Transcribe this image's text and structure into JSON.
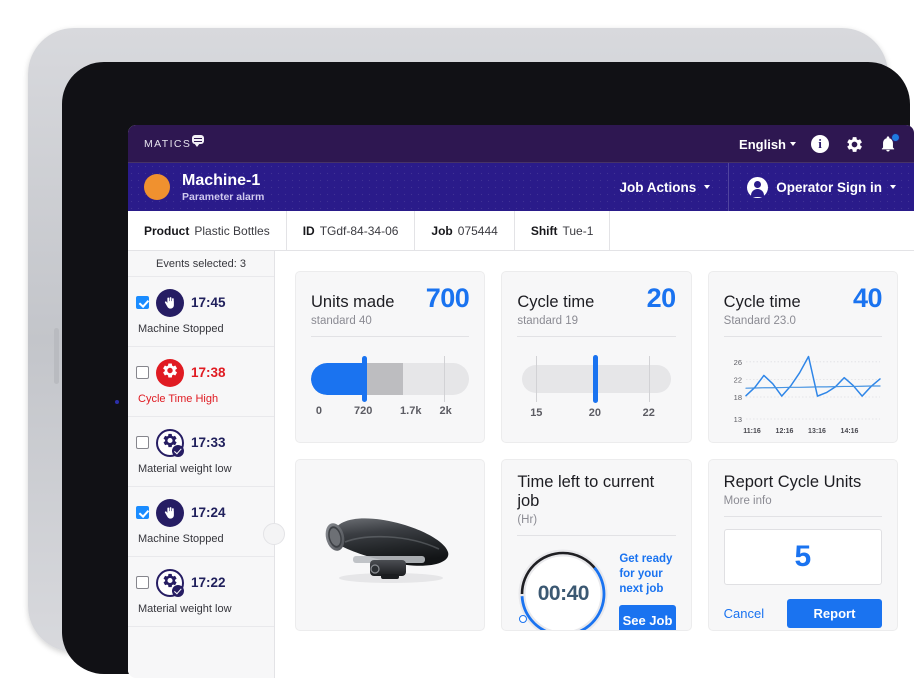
{
  "topbar": {
    "logo_text": "MATICS",
    "language": "English",
    "icons": [
      "info-icon",
      "gear-icon",
      "bell-icon"
    ],
    "notification_badge": ""
  },
  "machinebar": {
    "machine_name": "Machine-1",
    "machine_status": "Parameter alarm",
    "status_color": "#f0912f",
    "job_actions": "Job Actions",
    "operator": "Operator Sign in"
  },
  "infotabs": [
    {
      "label": "Product",
      "value": "Plastic Bottles"
    },
    {
      "label": "ID",
      "value": "TGdf-84-34-06"
    },
    {
      "label": "Job",
      "value": "075444"
    },
    {
      "label": "Shift",
      "value": "Tue-1"
    }
  ],
  "sidebar": {
    "header": "Events selected: 3",
    "events": [
      {
        "time": "17:45",
        "label": "Machine Stopped",
        "checked": true,
        "icon": "hand-stop-icon",
        "style": "navy"
      },
      {
        "time": "17:38",
        "label": "Cycle Time High",
        "checked": false,
        "icon": "gear-alert-icon",
        "style": "red"
      },
      {
        "time": "17:33",
        "label": "Material weight low",
        "checked": false,
        "icon": "gear-check-icon",
        "style": "outline"
      },
      {
        "time": "17:24",
        "label": "Machine Stopped",
        "checked": true,
        "icon": "hand-stop-icon",
        "style": "navy"
      },
      {
        "time": "17:22",
        "label": "Material weight low",
        "checked": false,
        "icon": "gear-check-icon",
        "style": "outline"
      }
    ]
  },
  "cards": {
    "units_made": {
      "title": "Units made",
      "value": "700",
      "subtitle": "standard 40",
      "ticks": [
        "0",
        "720",
        "1.7k",
        "2k"
      ]
    },
    "cycle_time_gauge": {
      "title": "Cycle time",
      "value": "20",
      "subtitle": "standard 19",
      "ticks": [
        "15",
        "20",
        "22"
      ]
    },
    "cycle_time_chart": {
      "title": "Cycle time",
      "value": "40",
      "subtitle": "Standard 23.0"
    },
    "product_image": {
      "alt": "shotgun-microphone-product-photo"
    },
    "timer": {
      "title": "Time left to current job",
      "subtitle": "(Hr)",
      "display": "00:40",
      "message": "Get ready for your next job",
      "button": "See Job"
    },
    "report": {
      "title": "Report Cycle Units",
      "subtitle": "More info",
      "value": "5",
      "cancel": "Cancel",
      "submit": "Report"
    }
  },
  "chart_data": {
    "type": "line",
    "title": "Cycle time",
    "subtitle": "Standard 23.0",
    "current_value": 40,
    "standard": 23.0,
    "xlabel": "",
    "ylabel": "",
    "yticks": [
      13,
      18,
      22,
      26
    ],
    "ylim": [
      13,
      28
    ],
    "xticks": [
      "11:16",
      "12:16",
      "13:16",
      "14:16"
    ],
    "grid": true,
    "legend": "none",
    "series": [
      {
        "name": "Cycle time",
        "color": "#2f86e8",
        "values": [
          18.3,
          20.2,
          22.9,
          21.0,
          18.2,
          20.5,
          23.5,
          27.2,
          18.2,
          19.0,
          20.3,
          22.4,
          20.6,
          18.2,
          20.4,
          22.1
        ]
      },
      {
        "name": "Trend",
        "color": "#3f8fe0",
        "values": [
          20.0,
          20.05,
          20.1,
          20.1,
          20.15,
          20.2,
          20.2,
          20.25,
          20.3,
          20.3,
          20.35,
          20.4,
          20.4,
          20.45,
          20.5,
          20.5
        ]
      }
    ]
  },
  "colors": {
    "accent_blue": "#1a73f0",
    "topbar_purple": "#2e1751",
    "machinebar_blue": "#2a1b8a",
    "alert_red": "#e01b22",
    "status_orange": "#f0912f"
  }
}
